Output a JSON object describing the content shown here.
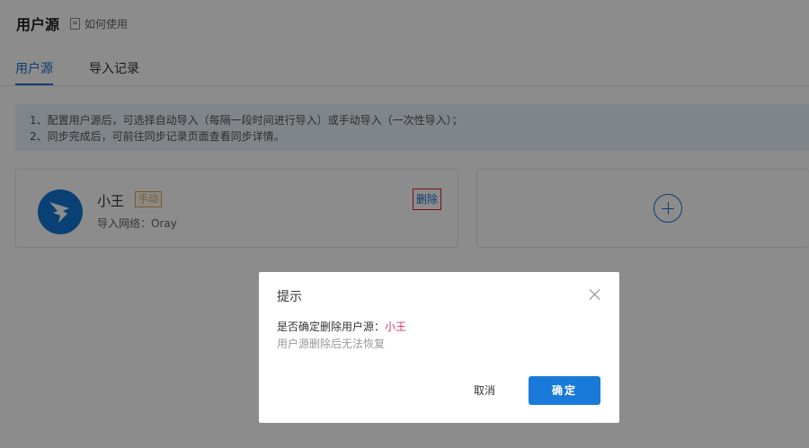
{
  "header": {
    "title": "用户源",
    "help_label": "如何使用"
  },
  "tabs": [
    {
      "label": "用户源",
      "active": true
    },
    {
      "label": "导入记录",
      "active": false
    }
  ],
  "notice": {
    "lines": [
      "1、配置用户源后，可选择自动导入（每隔一段时间进行导入）或手动导入（一次性导入）；",
      "2、同步完成后，可前往同步记录页面查看同步详情。"
    ]
  },
  "source_card": {
    "name": "小王",
    "mode_tag": "手动",
    "network": "导入网络：Oray",
    "delete_label": "删除",
    "icon": "dingtalk-logo-icon"
  },
  "add_card": {
    "icon": "plus-circle-icon"
  },
  "dialog": {
    "title": "提示",
    "message_prefix": "是否确定删除用户源：",
    "message_target": "小王",
    "sub_text": "用户源删除后无法恢复",
    "cancel_label": "取消",
    "ok_label": "确定"
  },
  "colors": {
    "accent": "#1a6fd1",
    "highlight": "#d6336c",
    "tag": "#d7a45b",
    "notice_bg": "#eaf3fb"
  }
}
